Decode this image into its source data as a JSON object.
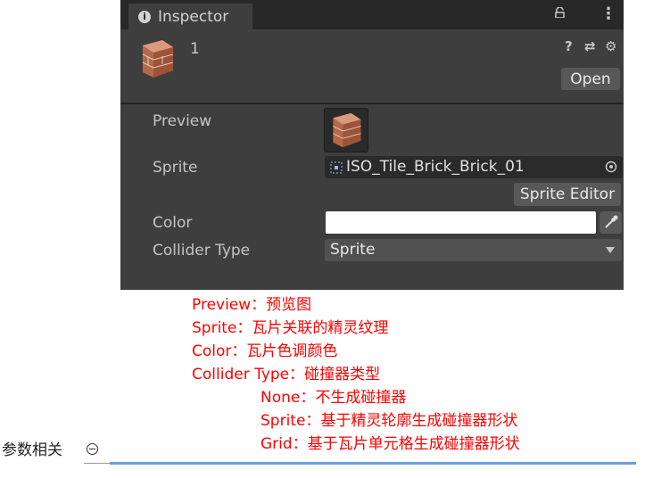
{
  "inspector": {
    "tab_title": "Inspector",
    "asset_name": "1",
    "open_label": "Open",
    "fields": {
      "preview_label": "Preview",
      "sprite_label": "Sprite",
      "sprite_value": "ISO_Tile_Brick_Brick_01",
      "sprite_editor_label": "Sprite Editor",
      "color_label": "Color",
      "color_value": "#ffffff",
      "collider_label": "Collider Type",
      "collider_value": "Sprite"
    },
    "icons": [
      "info-icon",
      "lock-icon",
      "kebab-menu-icon",
      "help-icon",
      "preset-icon",
      "settings-icon",
      "sprite-object-icon",
      "object-picker-icon",
      "eyedropper-icon",
      "dropdown-arrow-icon"
    ]
  },
  "notes": {
    "lines": [
      "Preview：预览图",
      "Sprite：瓦片关联的精灵纹理",
      "Color：瓦片色调颜色",
      "Collider Type：碰撞器类型"
    ],
    "sub_lines": [
      "None：不生成碰撞器",
      "Sprite：基于精灵轮廓生成碰撞器形状",
      "Grid：基于瓦片单元格生成碰撞器形状"
    ]
  },
  "section": {
    "title": "参数相关"
  },
  "colors": {
    "note_text": "#ff0000",
    "panel_bg": "#3e3e3e",
    "rule_accent": "#6a9ee0"
  }
}
